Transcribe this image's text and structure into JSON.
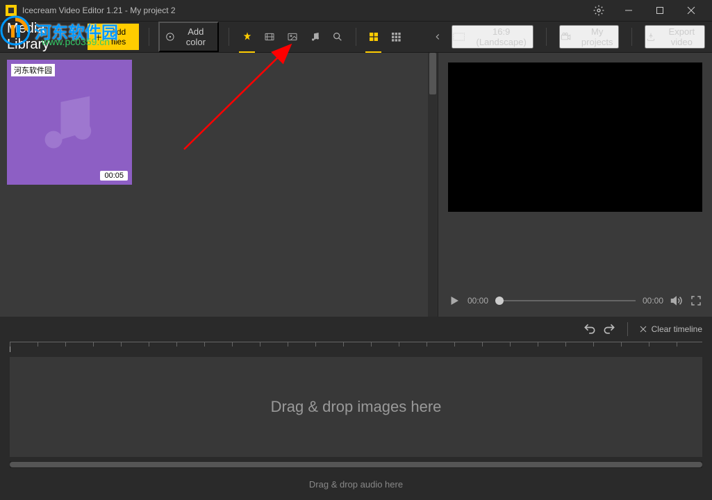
{
  "titlebar": {
    "title": "Icecream Video Editor 1.21 - My project 2"
  },
  "toolbar": {
    "media_library_label": "Media Library",
    "add_files_label": "Add files",
    "add_color_label": "Add color",
    "aspect_label": "16:9 (Landscape)",
    "my_projects_label": "My projects",
    "export_label": "Export video",
    "filter_icons": {
      "all": "all",
      "video": "video",
      "image": "image",
      "audio": "audio",
      "search": "search"
    },
    "view_icons": {
      "grid_large": "grid-large",
      "grid_small": "grid-small"
    }
  },
  "library": {
    "items": [
      {
        "tag": "河东软件园",
        "duration": "00:05"
      }
    ]
  },
  "preview": {
    "current_time": "00:00",
    "total_time": "00:00"
  },
  "timeline": {
    "clear_label": "Clear timeline",
    "video_placeholder": "Drag & drop images here",
    "audio_placeholder": "Drag & drop audio here"
  },
  "watermark": {
    "text": "河东软件园",
    "sub": "www.pc0359.cn"
  }
}
